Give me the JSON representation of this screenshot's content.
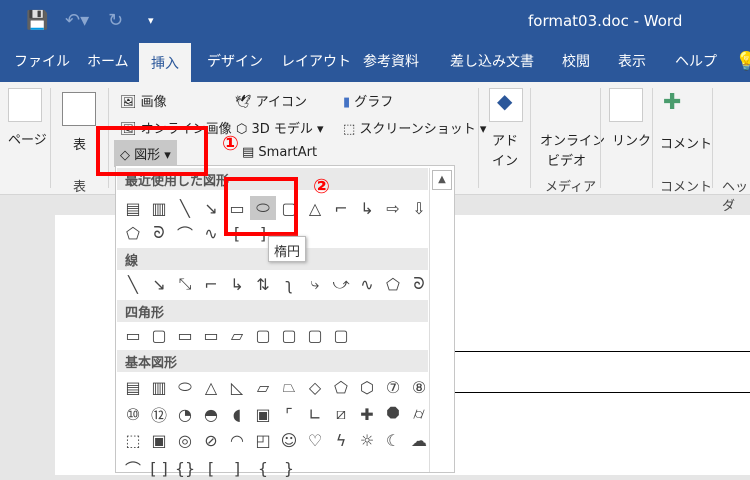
{
  "titlebar": {
    "title": "format03.doc  -  Word"
  },
  "tabs": [
    "ファイル",
    "ホーム",
    "挿入",
    "デザイン",
    "レイアウト",
    "参考資料",
    "差し込み文書",
    "校閲",
    "表示",
    "ヘルプ"
  ],
  "active_tab": "挿入",
  "ribbon": {
    "page": "ページ",
    "table": "表",
    "table_group": "表",
    "image": "画像",
    "online_image": "オンライン画像",
    "shapes": "図形",
    "icons": "アイコン",
    "model3d": "3D モデル",
    "smartart": "SmartArt",
    "chart": "グラフ",
    "screenshot": "スクリーンショット",
    "addin1": "アド",
    "addin2": "イン",
    "online_video1": "オンライン",
    "online_video2": "ビデオ",
    "media_group": "メディア",
    "link": "リンク",
    "comment": "コメント",
    "comment_group": "コメント",
    "header_group": "ヘッダ"
  },
  "panel": {
    "sections": [
      {
        "title": "最近使用した図形",
        "rows": [
          [
            "textbox",
            "vtextbox",
            "line",
            "arrow",
            "rectangle",
            "oval",
            "rounded-rect",
            "triangle",
            "elbow",
            "elbow-arrow",
            "right-arrow",
            "down-arrow"
          ],
          [
            "freeform",
            "scribble",
            "arc",
            "curve",
            "bracket-left",
            "bracket-right"
          ]
        ]
      },
      {
        "title": "線",
        "rows": [
          [
            "line",
            "arrow",
            "double-arrow",
            "elbow",
            "elbow-arrow",
            "elbow-double",
            "curve-conn",
            "curve-arrow",
            "curve-double",
            "curve",
            "freeform",
            "scribble"
          ]
        ]
      },
      {
        "title": "四角形",
        "rows": [
          [
            "rectangle",
            "rounded-rect",
            "snip1",
            "snip2",
            "snip-diag",
            "round1",
            "round2",
            "round-diag",
            "rounded-rect"
          ]
        ]
      },
      {
        "title": "基本図形",
        "rows": [
          [
            "textbox",
            "vtextbox",
            "oval",
            "triangle",
            "right-triangle",
            "parallelogram",
            "trapezoid",
            "diamond",
            "pentagon",
            "hexagon",
            "heptagon",
            "octagon"
          ],
          [
            "decagon",
            "dodecagon",
            "pie",
            "chord",
            "teardrop",
            "frame",
            "half-frame",
            "l-shape",
            "diag-stripe",
            "cross",
            "plaque",
            "can"
          ],
          [
            "cube",
            "bevel",
            "donut",
            "no-symbol",
            "block-arc",
            "folded-corner",
            "smiley",
            "heart",
            "lightning",
            "sun",
            "moon",
            "cloud"
          ],
          [
            "arc",
            "bracket-pair",
            "brace-pair",
            "bracket-left",
            "bracket-right",
            "brace-left",
            "brace-right"
          ]
        ]
      }
    ],
    "selected": "oval",
    "tooltip": "楕円"
  },
  "annotations": {
    "step1": "①",
    "step2": "②"
  }
}
